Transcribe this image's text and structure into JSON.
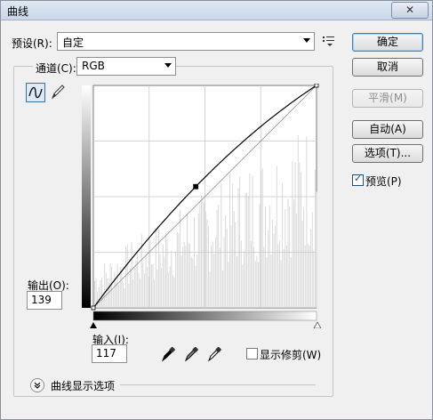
{
  "window": {
    "title": "曲线",
    "close_glyph": "✕"
  },
  "preset": {
    "label": "预设(R):",
    "value": "自定"
  },
  "channel": {
    "label": "通道(C):",
    "value": "RGB"
  },
  "buttons": {
    "ok": "确定",
    "cancel": "取消",
    "smooth": "平滑(M)",
    "auto": "自动(A)",
    "options": "选项(T)..."
  },
  "preview": {
    "label": "预览(P)",
    "checked": true
  },
  "output": {
    "label": "输出(O):",
    "value": "139"
  },
  "input": {
    "label": "输入(I):",
    "value": "117"
  },
  "show_clipping": {
    "label": "显示修剪(W)",
    "checked": false
  },
  "curve_display_options": {
    "label": "曲线显示选项"
  },
  "curve": {
    "control_points": [
      [
        0,
        0
      ],
      [
        117,
        139
      ],
      [
        255,
        255
      ]
    ],
    "range": [
      0,
      255
    ]
  },
  "colors": {
    "accent": "#3c7fb1",
    "grid": "#c9c9c9",
    "histogram": "#d6d6d6"
  },
  "icons": {
    "preset_menu": "list-menu-icon",
    "curve_tool": "curve-tool-icon",
    "pencil_tool": "pencil-icon",
    "black_point": "black-eyedropper-icon",
    "gray_point": "gray-eyedropper-icon",
    "white_point": "white-eyedropper-icon",
    "expand": "chevron-double-down-icon"
  }
}
